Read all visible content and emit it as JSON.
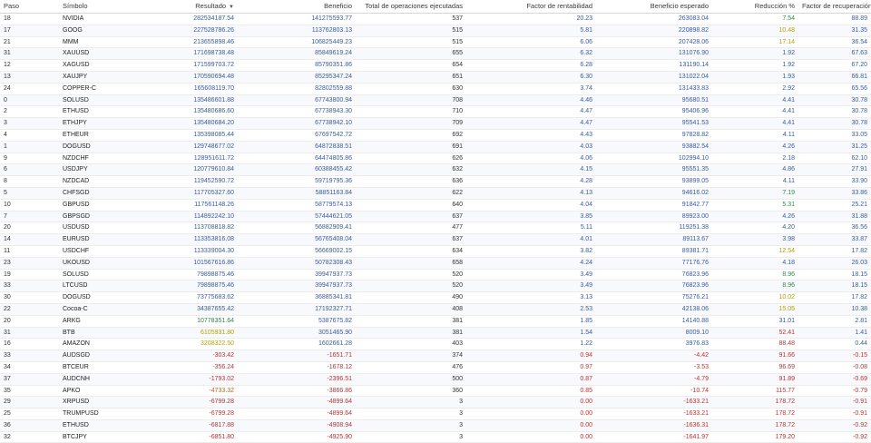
{
  "headers": [
    "Paso",
    "Símbolo",
    "Resultado",
    "Beneficio",
    "Total de operaciones ejecutadas",
    "Factor de rentabilidad",
    "Beneficio esperado",
    "Reducción %",
    "Factor de recuperación"
  ],
  "sort_icon": "▼",
  "colors": {
    "blue": "#3a5ba6",
    "red": "#c23030",
    "green": "#2f8a4a",
    "yellow": "#b8a200",
    "orange": "#c7621a"
  },
  "rows": [
    [
      "18",
      "NVIDIA",
      "282534187.54",
      "141275593.77",
      "537",
      "20.23",
      "263083.04",
      "7.54",
      "88.89"
    ],
    [
      "17",
      "GOOG",
      "227528786.26",
      "113762803.13",
      "515",
      "5.81",
      "220898.82",
      "10.48",
      "31.35"
    ],
    [
      "21",
      "MMM",
      "213655898.46",
      "106825449.23",
      "515",
      "6.06",
      "207428.06",
      "17.14",
      "36.54"
    ],
    [
      "31",
      "XAUUSD",
      "171698738.48",
      "85849619.24",
      "655",
      "6.32",
      "131076.90",
      "1.92",
      "67.63"
    ],
    [
      "12",
      "XAGUSD",
      "171599703.72",
      "85790351.86",
      "654",
      "6.28",
      "131190.14",
      "1.92",
      "67.20"
    ],
    [
      "13",
      "XAUJPY",
      "170590694.48",
      "85295347.24",
      "651",
      "6.30",
      "131022.04",
      "1.93",
      "66.81"
    ],
    [
      "24",
      "COPPER-C",
      "165608119.70",
      "82802559.88",
      "630",
      "3.74",
      "131433.83",
      "2.92",
      "65.56"
    ],
    [
      "0",
      "SOLUSD",
      "135486601.88",
      "67743800.94",
      "708",
      "4.46",
      "95680.51",
      "4.41",
      "30.78"
    ],
    [
      "2",
      "ETHUSD",
      "135480686.60",
      "67738943.30",
      "710",
      "4.47",
      "95406.96",
      "4.41",
      "30.78"
    ],
    [
      "3",
      "ETHJPY",
      "135480684.20",
      "67738942.10",
      "709",
      "4.47",
      "95541.53",
      "4.41",
      "30.78"
    ],
    [
      "4",
      "ETHEUR",
      "135398085.44",
      "67697542.72",
      "692",
      "4.43",
      "97828.82",
      "4.11",
      "33.05"
    ],
    [
      "1",
      "DOGUSD",
      "129748677.02",
      "64872838.51",
      "691",
      "4.03",
      "93882.54",
      "4.26",
      "31.25"
    ],
    [
      "9",
      "NZDCHF",
      "128951611.72",
      "64474805.86",
      "626",
      "4.06",
      "102994.10",
      "2.18",
      "62.10"
    ],
    [
      "6",
      "USDJPY",
      "120779610.84",
      "60388455.42",
      "632",
      "4.15",
      "95551.35",
      "4.86",
      "27.91"
    ],
    [
      "8",
      "NZDCAD",
      "119452590.72",
      "59719795.36",
      "636",
      "4.28",
      "93899.05",
      "4.11",
      "33.90"
    ],
    [
      "5",
      "CHFSGD",
      "117705327.60",
      "58851163.84",
      "622",
      "4.13",
      "94616.02",
      "7.19",
      "33.86"
    ],
    [
      "10",
      "GBPUSD",
      "117561148.26",
      "58779574.13",
      "640",
      "4.04",
      "91842.77",
      "5.31",
      "25.21"
    ],
    [
      "7",
      "GBPSGD",
      "114892242.10",
      "57444621.05",
      "637",
      "3.85",
      "89923.00",
      "4.26",
      "31.88"
    ],
    [
      "20",
      "USDUSD",
      "113708818.82",
      "56882909.41",
      "477",
      "5.11",
      "119251.38",
      "4.20",
      "36.56"
    ],
    [
      "14",
      "EURUSD",
      "113353816.08",
      "56765408.04",
      "637",
      "4.01",
      "89113.67",
      "3.98",
      "33.87"
    ],
    [
      "11",
      "USDCHF",
      "113339004.30",
      "56669002.15",
      "634",
      "3.82",
      "89381.71",
      "12.54",
      "17.82"
    ],
    [
      "23",
      "UKOUSD",
      "101567616.86",
      "50782308.43",
      "658",
      "4.24",
      "77176.76",
      "4.18",
      "26.03"
    ],
    [
      "19",
      "SOLUSD",
      "79898875.46",
      "39947937.73",
      "520",
      "3.49",
      "76823.96",
      "8.96",
      "18.15"
    ],
    [
      "33",
      "LTCUSD",
      "79898875.46",
      "39947937.73",
      "520",
      "3.49",
      "76823.96",
      "8.96",
      "18.15"
    ],
    [
      "30",
      "DOGUSD",
      "73775683.62",
      "36885341.81",
      "490",
      "3.13",
      "75276.21",
      "10.02",
      "17.82"
    ],
    [
      "22",
      "Cocoa-C",
      "34387655.42",
      "17192327.71",
      "408",
      "2.53",
      "42138.06",
      "15.05",
      "10.38"
    ],
    [
      "20",
      "ARKG",
      "10778351.64",
      "5387675.82",
      "381",
      "1.85",
      "14140.88",
      "31.01",
      "2.81"
    ],
    [
      "31",
      "BTB",
      "6105931.80",
      "3051465.90",
      "381",
      "1.54",
      "8009.10",
      "52.41",
      "1.41"
    ],
    [
      "16",
      "AMAZON",
      "3208322.50",
      "1602661.28",
      "403",
      "1.22",
      "3976.83",
      "88.48",
      "0.44"
    ],
    [
      "33",
      "AUDSGD",
      "-303.42",
      "-1651.71",
      "374",
      "0.94",
      "-4.42",
      "91.66",
      "-0.15"
    ],
    [
      "34",
      "BTCEUR",
      "-356.24",
      "-1678.12",
      "476",
      "0.97",
      "-3.53",
      "96.69",
      "-0.08"
    ],
    [
      "37",
      "AUDCNH",
      "-1793.02",
      "-2396.51",
      "500",
      "0.87",
      "-4.79",
      "91.89",
      "-0.69"
    ],
    [
      "35",
      "APKO",
      "-4733.32",
      "-3866.86",
      "360",
      "0.85",
      "-10.74",
      "115.77",
      "-0.79"
    ],
    [
      "29",
      "XRPUSD",
      "-6799.28",
      "-4899.64",
      "3",
      "0.00",
      "-1633.21",
      "178.72",
      "-0.91"
    ],
    [
      "25",
      "TRUMPUSD",
      "-6799.28",
      "-4899.64",
      "3",
      "0.00",
      "-1633.21",
      "178.72",
      "-0.91"
    ],
    [
      "36",
      "ETHUSD",
      "-6817.88",
      "-4908.94",
      "3",
      "0.00",
      "-1636.31",
      "178.72",
      "-0.92"
    ],
    [
      "32",
      "BTCJPY",
      "-6851.80",
      "-4925.90",
      "3",
      "0.00",
      "-1641.97",
      "179.20",
      "-0.92"
    ]
  ],
  "result_color": [
    "blue",
    "blue",
    "blue",
    "blue",
    "blue",
    "blue",
    "blue",
    "blue",
    "blue",
    "blue",
    "blue",
    "blue",
    "blue",
    "blue",
    "blue",
    "blue",
    "blue",
    "blue",
    "blue",
    "blue",
    "blue",
    "blue",
    "blue",
    "blue",
    "blue",
    "blue",
    "green",
    "yellow",
    "yellow",
    "red",
    "red",
    "red",
    "orange",
    "red",
    "red",
    "red",
    "red"
  ],
  "reduction_color": [
    "green",
    "yellow",
    "yellow",
    "blue",
    "blue",
    "blue",
    "blue",
    "blue",
    "blue",
    "blue",
    "blue",
    "blue",
    "blue",
    "blue",
    "blue",
    "green",
    "green",
    "blue",
    "blue",
    "blue",
    "yellow",
    "blue",
    "green",
    "green",
    "yellow",
    "yellow",
    "blue",
    "red",
    "red",
    "red",
    "red",
    "red",
    "red",
    "red",
    "red",
    "red",
    "red"
  ]
}
